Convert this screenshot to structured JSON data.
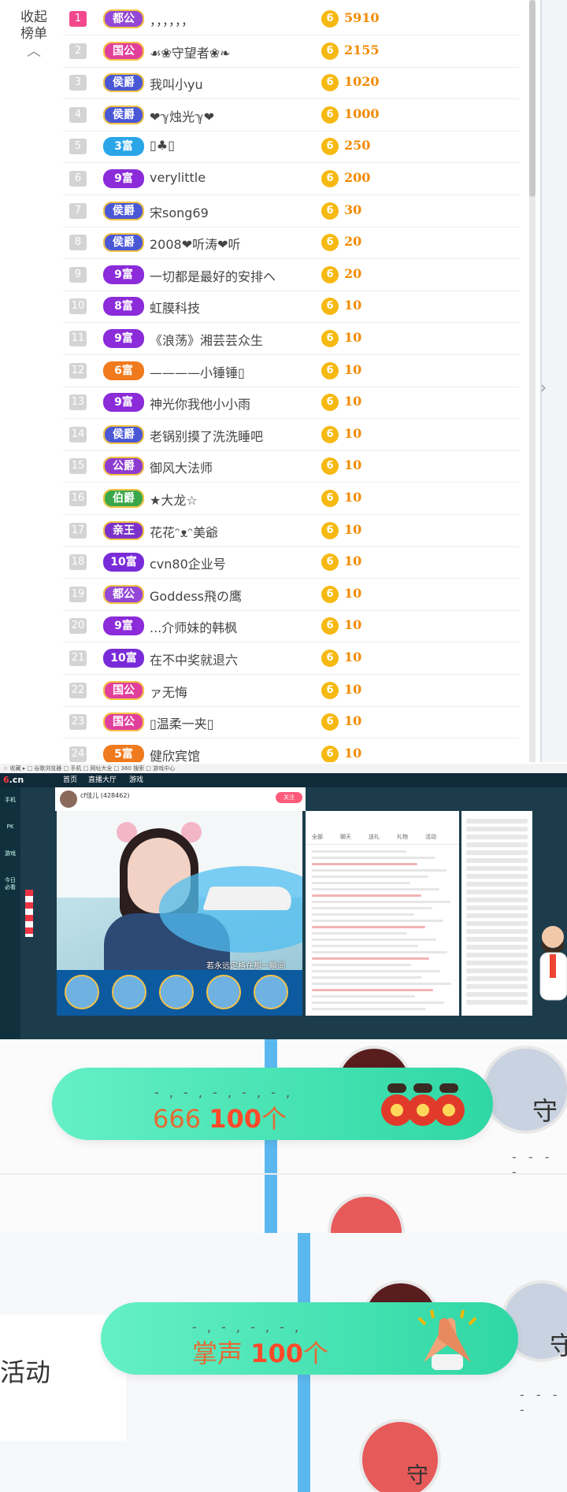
{
  "rank_panel": {
    "collapse_label": "收起\n榜单",
    "rows": [
      {
        "rank": "1",
        "badge": "都公",
        "name": "，，，，，，",
        "score": "5910"
      },
      {
        "rank": "2",
        "badge": "国公",
        "name": "☙❀守望者❀❧",
        "score": "2155"
      },
      {
        "rank": "3",
        "badge": "侯爵",
        "name": "我叫小yu",
        "score": "1020"
      },
      {
        "rank": "4",
        "badge": "侯爵",
        "name": "❤ℽ烛光ℽ❤",
        "score": "1000"
      },
      {
        "rank": "5",
        "badge": "3富",
        "name": "▯♣▯",
        "score": "250"
      },
      {
        "rank": "6",
        "badge": "9富",
        "name": "verylittle",
        "score": "200"
      },
      {
        "rank": "7",
        "badge": "侯爵",
        "name": "宋song69",
        "score": "30"
      },
      {
        "rank": "8",
        "badge": "侯爵",
        "name": "2008❤听涛❤听",
        "score": "20"
      },
      {
        "rank": "9",
        "badge": "9富",
        "name": "一切都是最好的安排ヘ",
        "score": "20"
      },
      {
        "rank": "10",
        "badge": "8富",
        "name": "虹膜科技",
        "score": "10"
      },
      {
        "rank": "11",
        "badge": "9富",
        "name": "《浪荡》湘芸芸众生",
        "score": "10"
      },
      {
        "rank": "12",
        "badge": "6富",
        "name": "————小锤锤▯",
        "score": "10"
      },
      {
        "rank": "13",
        "badge": "9富",
        "name": "神光你我他小小雨",
        "score": "10"
      },
      {
        "rank": "14",
        "badge": "侯爵",
        "name": "老锅别摸了洗洗睡吧",
        "score": "10"
      },
      {
        "rank": "15",
        "badge": "公爵",
        "name": "御风大法师",
        "score": "10"
      },
      {
        "rank": "16",
        "badge": "伯爵",
        "name": "★大龙☆",
        "score": "10"
      },
      {
        "rank": "17",
        "badge": "亲王",
        "name": "花花ᵔᴥᵔ美爺",
        "score": "10"
      },
      {
        "rank": "18",
        "badge": "10富",
        "name": "cvn80企业号",
        "score": "10"
      },
      {
        "rank": "19",
        "badge": "都公",
        "name": "Goddess飛の鹰",
        "score": "10"
      },
      {
        "rank": "20",
        "badge": "9富",
        "name": "...介师妹的韩枫",
        "score": "10"
      },
      {
        "rank": "21",
        "badge": "10富",
        "name": "在不中奖就退六",
        "score": "10"
      },
      {
        "rank": "22",
        "badge": "国公",
        "name": "ァ无悔",
        "score": "10"
      },
      {
        "rank": "23",
        "badge": "国公",
        "name": "▯温柔一夹▯",
        "score": "10"
      },
      {
        "rank": "24",
        "badge": "5富",
        "name": "健欣宾馆",
        "score": "10"
      }
    ],
    "coin_glyph": "6",
    "side_arrow": "›"
  },
  "stream_panel": {
    "browser_bar": "☆ 收藏 ▸ □ 谷歌浏览器 □ 手机 □ 网址大全 □ 360 搜索 □ 游戏中心",
    "logo_main": "6",
    "logo_suffix": ".cn",
    "nav": [
      "首页",
      "直播大厅",
      "游戏",
      "PK"
    ],
    "anchor_name": "cf佳儿 (428462)",
    "follow_label": "关注",
    "caption": "若永远定格在那一瞬间",
    "chat_tabs": [
      "全部",
      "聊天",
      "送礼",
      "礼物",
      "活动"
    ],
    "left_nav": [
      "手机",
      "PK",
      "游戏",
      "今日必看"
    ]
  },
  "barrage_1": {
    "dots": "- , - , - , - , - ,",
    "gift_name": "666 ",
    "gift_count": "100",
    "unit": "个",
    "side_badge": "守",
    "avatar_dots": "- - - -"
  },
  "barrage_2": {
    "dots": "- , - , - , - ,",
    "gift_name": "掌声 ",
    "gift_count": "100",
    "unit": "个",
    "left_text": "活动",
    "side_badge": "守",
    "bottom_badge": "守",
    "avatar_dots": "- - - -"
  }
}
